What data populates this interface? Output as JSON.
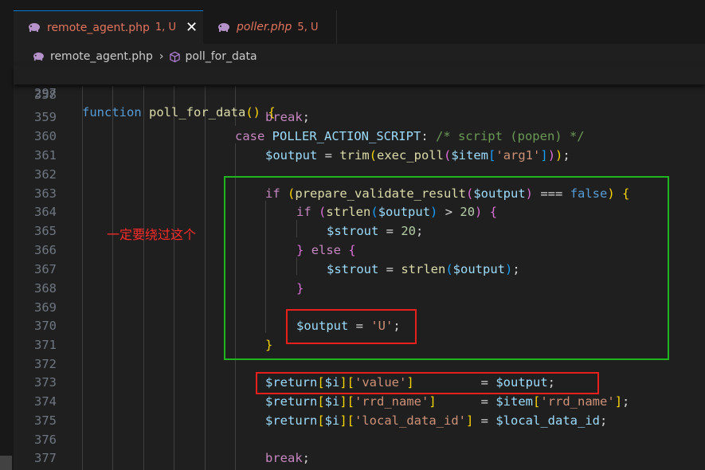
{
  "tabs": [
    {
      "name": "remote_agent.php",
      "status": "1, U",
      "active": true
    },
    {
      "name": "poller.php",
      "status": "5, U",
      "active": false
    }
  ],
  "breadcrumb": {
    "file": "remote_agent.php",
    "symbol": "poll_for_data"
  },
  "sticky_line": {
    "number": "297",
    "code": "function poll_for_data() {"
  },
  "code_lines": [
    {
      "n": "358",
      "code": ""
    },
    {
      "n": "359",
      "code": "break;"
    },
    {
      "n": "360",
      "code": "case POLLER_ACTION_SCRIPT: /* script (popen) */"
    },
    {
      "n": "361",
      "code": "$output = trim(exec_poll($item['arg1']));"
    },
    {
      "n": "362",
      "code": ""
    },
    {
      "n": "363",
      "code": "if (prepare_validate_result($output) === false) {"
    },
    {
      "n": "364",
      "code": "if (strlen($output) > 20) {"
    },
    {
      "n": "365",
      "code": "$strout = 20;"
    },
    {
      "n": "366",
      "code": "} else {"
    },
    {
      "n": "367",
      "code": "$strout = strlen($output);"
    },
    {
      "n": "368",
      "code": "}"
    },
    {
      "n": "369",
      "code": ""
    },
    {
      "n": "370",
      "code": "$output = 'U';"
    },
    {
      "n": "371",
      "code": "}"
    },
    {
      "n": "372",
      "code": ""
    },
    {
      "n": "373",
      "code": "$return[$i]['value']         = $output;"
    },
    {
      "n": "374",
      "code": "$return[$i]['rrd_name']      = $item['rrd_name'];"
    },
    {
      "n": "375",
      "code": "$return[$i]['local_data_id'] = $local_data_id;"
    },
    {
      "n": "376",
      "code": ""
    },
    {
      "n": "377",
      "code": "break;"
    }
  ],
  "annotation": {
    "text": "一定要绕过这个",
    "color": "#ff2a2a"
  },
  "colors": {
    "editor_bg": "#1f1f1f",
    "green_box": "#1fb51f",
    "red_box": "#e8201c",
    "tab_accent": "#0078d4"
  },
  "icons": [
    "php-elephant-icon",
    "close-icon",
    "chevron-right-icon",
    "symbol-method-icon"
  ]
}
